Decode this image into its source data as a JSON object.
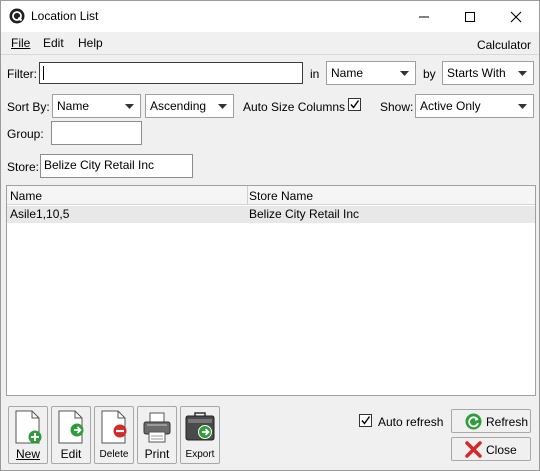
{
  "window": {
    "title": "Location List"
  },
  "menu": {
    "file": "File",
    "edit": "Edit",
    "help": "Help",
    "calculator": "Calculator"
  },
  "filter": {
    "label": "Filter:",
    "value": "",
    "in_label": "in",
    "field": "Name",
    "by_label": "by",
    "mode": "Starts With"
  },
  "sort": {
    "label": "Sort By:",
    "field": "Name",
    "direction": "Ascending",
    "auto_size_label": "Auto Size Columns",
    "auto_size_checked": true,
    "show_label": "Show:",
    "show_value": "Active Only"
  },
  "group": {
    "label": "Group:",
    "value": ""
  },
  "store": {
    "label": "Store:",
    "value": "Belize City Retail Inc"
  },
  "grid": {
    "columns": [
      "Name",
      "Store Name"
    ],
    "rows": [
      [
        "Asile1,10,5",
        "Belize City Retail Inc"
      ]
    ]
  },
  "toolbar": {
    "new": "New",
    "edit": "Edit",
    "delete": "Delete",
    "print": "Print",
    "export": "Export"
  },
  "footer": {
    "auto_refresh_label": "Auto refresh",
    "auto_refresh_checked": true,
    "refresh": "Refresh",
    "close": "Close"
  },
  "icons": {
    "app": "app-logo-icon",
    "new": "new-document-icon",
    "edit": "edit-document-icon",
    "delete": "delete-document-icon",
    "print": "printer-icon",
    "export": "export-briefcase-icon",
    "refresh": "refresh-icon",
    "close": "close-x-icon"
  },
  "colors": {
    "accent_green": "#2e9e3a",
    "close_red": "#d22a2a"
  }
}
